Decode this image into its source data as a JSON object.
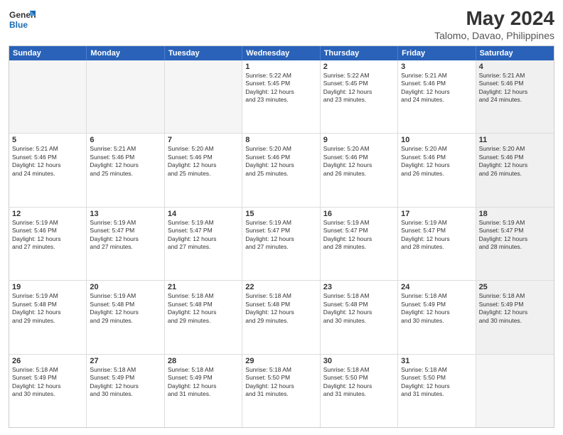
{
  "header": {
    "logo_line1": "General",
    "logo_line2": "Blue",
    "title": "May 2024",
    "subtitle": "Talomo, Davao, Philippines"
  },
  "days_of_week": [
    "Sunday",
    "Monday",
    "Tuesday",
    "Wednesday",
    "Thursday",
    "Friday",
    "Saturday"
  ],
  "weeks": [
    [
      {
        "day": "",
        "info": "",
        "empty": true
      },
      {
        "day": "",
        "info": "",
        "empty": true
      },
      {
        "day": "",
        "info": "",
        "empty": true
      },
      {
        "day": "1",
        "info": "Sunrise: 5:22 AM\nSunset: 5:45 PM\nDaylight: 12 hours\nand 23 minutes."
      },
      {
        "day": "2",
        "info": "Sunrise: 5:22 AM\nSunset: 5:45 PM\nDaylight: 12 hours\nand 23 minutes."
      },
      {
        "day": "3",
        "info": "Sunrise: 5:21 AM\nSunset: 5:46 PM\nDaylight: 12 hours\nand 24 minutes."
      },
      {
        "day": "4",
        "info": "Sunrise: 5:21 AM\nSunset: 5:46 PM\nDaylight: 12 hours\nand 24 minutes.",
        "shaded": true
      }
    ],
    [
      {
        "day": "5",
        "info": "Sunrise: 5:21 AM\nSunset: 5:46 PM\nDaylight: 12 hours\nand 24 minutes."
      },
      {
        "day": "6",
        "info": "Sunrise: 5:21 AM\nSunset: 5:46 PM\nDaylight: 12 hours\nand 25 minutes."
      },
      {
        "day": "7",
        "info": "Sunrise: 5:20 AM\nSunset: 5:46 PM\nDaylight: 12 hours\nand 25 minutes."
      },
      {
        "day": "8",
        "info": "Sunrise: 5:20 AM\nSunset: 5:46 PM\nDaylight: 12 hours\nand 25 minutes."
      },
      {
        "day": "9",
        "info": "Sunrise: 5:20 AM\nSunset: 5:46 PM\nDaylight: 12 hours\nand 26 minutes."
      },
      {
        "day": "10",
        "info": "Sunrise: 5:20 AM\nSunset: 5:46 PM\nDaylight: 12 hours\nand 26 minutes."
      },
      {
        "day": "11",
        "info": "Sunrise: 5:20 AM\nSunset: 5:46 PM\nDaylight: 12 hours\nand 26 minutes.",
        "shaded": true
      }
    ],
    [
      {
        "day": "12",
        "info": "Sunrise: 5:19 AM\nSunset: 5:46 PM\nDaylight: 12 hours\nand 27 minutes."
      },
      {
        "day": "13",
        "info": "Sunrise: 5:19 AM\nSunset: 5:47 PM\nDaylight: 12 hours\nand 27 minutes."
      },
      {
        "day": "14",
        "info": "Sunrise: 5:19 AM\nSunset: 5:47 PM\nDaylight: 12 hours\nand 27 minutes."
      },
      {
        "day": "15",
        "info": "Sunrise: 5:19 AM\nSunset: 5:47 PM\nDaylight: 12 hours\nand 27 minutes."
      },
      {
        "day": "16",
        "info": "Sunrise: 5:19 AM\nSunset: 5:47 PM\nDaylight: 12 hours\nand 28 minutes."
      },
      {
        "day": "17",
        "info": "Sunrise: 5:19 AM\nSunset: 5:47 PM\nDaylight: 12 hours\nand 28 minutes."
      },
      {
        "day": "18",
        "info": "Sunrise: 5:19 AM\nSunset: 5:47 PM\nDaylight: 12 hours\nand 28 minutes.",
        "shaded": true
      }
    ],
    [
      {
        "day": "19",
        "info": "Sunrise: 5:19 AM\nSunset: 5:48 PM\nDaylight: 12 hours\nand 29 minutes."
      },
      {
        "day": "20",
        "info": "Sunrise: 5:19 AM\nSunset: 5:48 PM\nDaylight: 12 hours\nand 29 minutes."
      },
      {
        "day": "21",
        "info": "Sunrise: 5:18 AM\nSunset: 5:48 PM\nDaylight: 12 hours\nand 29 minutes."
      },
      {
        "day": "22",
        "info": "Sunrise: 5:18 AM\nSunset: 5:48 PM\nDaylight: 12 hours\nand 29 minutes."
      },
      {
        "day": "23",
        "info": "Sunrise: 5:18 AM\nSunset: 5:48 PM\nDaylight: 12 hours\nand 30 minutes."
      },
      {
        "day": "24",
        "info": "Sunrise: 5:18 AM\nSunset: 5:49 PM\nDaylight: 12 hours\nand 30 minutes."
      },
      {
        "day": "25",
        "info": "Sunrise: 5:18 AM\nSunset: 5:49 PM\nDaylight: 12 hours\nand 30 minutes.",
        "shaded": true
      }
    ],
    [
      {
        "day": "26",
        "info": "Sunrise: 5:18 AM\nSunset: 5:49 PM\nDaylight: 12 hours\nand 30 minutes."
      },
      {
        "day": "27",
        "info": "Sunrise: 5:18 AM\nSunset: 5:49 PM\nDaylight: 12 hours\nand 30 minutes."
      },
      {
        "day": "28",
        "info": "Sunrise: 5:18 AM\nSunset: 5:49 PM\nDaylight: 12 hours\nand 31 minutes."
      },
      {
        "day": "29",
        "info": "Sunrise: 5:18 AM\nSunset: 5:50 PM\nDaylight: 12 hours\nand 31 minutes."
      },
      {
        "day": "30",
        "info": "Sunrise: 5:18 AM\nSunset: 5:50 PM\nDaylight: 12 hours\nand 31 minutes."
      },
      {
        "day": "31",
        "info": "Sunrise: 5:18 AM\nSunset: 5:50 PM\nDaylight: 12 hours\nand 31 minutes."
      },
      {
        "day": "",
        "info": "",
        "empty": true
      }
    ]
  ]
}
